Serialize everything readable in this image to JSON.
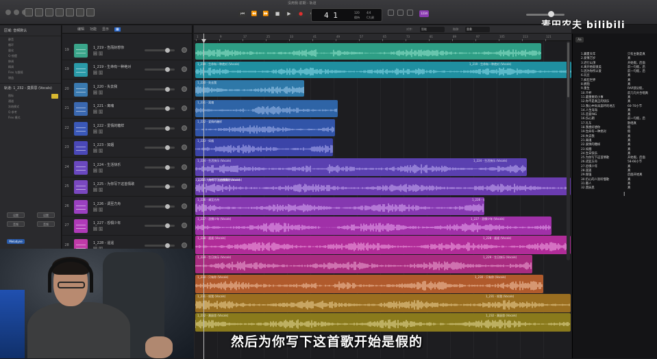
{
  "window": {
    "title": "没用我·前期 - 轨道"
  },
  "transport": {
    "rewind": "⏮",
    "back": "⏪",
    "forward": "⏩",
    "stop": "■",
    "play": "▶",
    "record": "●",
    "cycle": "⟳",
    "bar_beat": "4 1",
    "tempo": "120",
    "tempo_label": "保持",
    "key": "C大调",
    "signature": "4/4"
  },
  "badge": "1234",
  "watermark": "麦田农夫 bilibili",
  "inspector": {
    "region_header": "区域: 音频默认",
    "region_rows": [
      "静音",
      "循环",
      "量化",
      "Q-摇摆",
      "移调",
      "精调",
      "Flex 与跟随",
      "增益"
    ],
    "track_header": "轨道: 1_232 - 莫辰思 (Vocals)",
    "track_rows": [
      "图标",
      "通道",
      "冻结模式",
      "Q-参考",
      "Flex 模式"
    ],
    "btn_left": "设置",
    "btn_right": "设置",
    "btn_left2": "音频",
    "btn_right2": "音频",
    "blue_label": "Melodyne"
  },
  "track_toolbar": {
    "edit": "编辑",
    "functions": "功能",
    "view": "显示",
    "snap": "对齐",
    "drag": "拖移"
  },
  "edit_toolbar": {
    "snap_label": "对齐:",
    "snap_value": "智能",
    "drag_label": "拖移:",
    "drag_value": "重叠"
  },
  "ruler": [
    "1",
    "9",
    "17",
    "25",
    "33",
    "41",
    "49",
    "57",
    "65",
    "73",
    "81",
    "89",
    "97",
    "105",
    "113",
    "121"
  ],
  "tracks": [
    {
      "num": "19",
      "name": "1_219 - 告而好想你",
      "color": "#3aa58a"
    },
    {
      "num": "19",
      "name": "1_219 - 生命有一种绝对",
      "color": "#2a9aa8"
    },
    {
      "num": "20",
      "name": "1_220 - 失去我",
      "color": "#3a7ab0"
    },
    {
      "num": "21",
      "name": "1_221 - 离魂",
      "color": "#3a68b0"
    },
    {
      "num": "22",
      "name": "1_222 - 爱情的糖样",
      "color": "#3a58b8"
    },
    {
      "num": "23",
      "name": "1_223 - 如烟",
      "color": "#4a48b8"
    },
    {
      "num": "24",
      "name": "1_224 - 生活快乐",
      "color": "#6a48c0"
    },
    {
      "num": "25",
      "name": "1_225 - 为你写下这首情歌",
      "color": "#7a48c0"
    },
    {
      "num": "26",
      "name": "1_226 - 调至方舟",
      "color": "#9a40c0"
    },
    {
      "num": "27",
      "name": "1_227 - 恐惧少年",
      "color": "#b03ab8"
    },
    {
      "num": "28",
      "name": "1_228 - 遥遥",
      "color": "#c03aa8"
    }
  ],
  "regions": [
    {
      "label": "",
      "label2": "",
      "color": "#2e9e85",
      "light": "#8ee0c8"
    },
    {
      "label": "1_219 - 生命有一种绝对 (Vocals)",
      "label2": "1_219 - 生命有一种绝对 (Vocals)",
      "color": "#1f8fa0",
      "light": "#86d8e6"
    },
    {
      "label": "1_220 - 失去我",
      "label2": "",
      "color": "#2e78a8",
      "light": "#9cc8ea"
    },
    {
      "label": "1_221 - 离魂",
      "label2": "",
      "color": "#2e64a6",
      "light": "#9ab8e8"
    },
    {
      "label": "1_222 - 爱情的糖样",
      "label2": "",
      "color": "#3154a8",
      "light": "#a0b0ea"
    },
    {
      "label": "1_223 - 如烟",
      "label2": "",
      "color": "#3b44a8",
      "light": "#a8a8ee"
    },
    {
      "label": "1_224 - 生活快乐 (Vocals)",
      "label2": "1_224 - 生活快乐 (Vocals)",
      "color": "#5a40b0",
      "light": "#b8a8f0"
    },
    {
      "label": "1_225 - 为你写下这首情歌 (Vocals)",
      "label2": "1_225 - 为你写下这首情歌 (Vocals)",
      "color": "#6a3cb0",
      "light": "#c4a8f0"
    },
    {
      "label": "1_226 - 调至方舟",
      "label2": "1_226 - 调至方舟",
      "color": "#8538b0",
      "light": "#d4a4f0"
    },
    {
      "label": "1_227 - 恐惧少年 (Vocals)",
      "label2": "1_227 - 恐惧少年 (Vocals)",
      "color": "#a030a8",
      "light": "#e2a0ec"
    },
    {
      "label": "1_228 - 遥遥 (Vocals)",
      "label2": "1_228 - 遥遥 (Vocals)",
      "color": "#b02c98",
      "light": "#eea0e0"
    },
    {
      "label": "1_229 - 生日快乐 (Vocals)",
      "label2": "1_229 - 生日快乐 (Vocals)",
      "color": "#a82c80",
      "light": "#eaa0d0"
    },
    {
      "label": "1_230 - 只有你 (Vocals)",
      "label2": "1_230 - 只有你 (Vocals)",
      "color": "#b05a2c",
      "light": "#f0c0a0"
    },
    {
      "label": "1_231 - 如我 (Vocals)",
      "label2": "1_231 - 如我 (Vocals)",
      "color": "#9a6e20",
      "light": "#e8cc90"
    },
    {
      "label": "1_232 - 莫辰思 (Vocals)",
      "label2": "1_232 - 莫辰思 (Vocals)",
      "color": "#8a7a1c",
      "light": "#e0d490"
    }
  ],
  "song_list": [
    {
      "title": "1.藏夏天年",
      "note": "只有主歌是真"
    },
    {
      "title": "2.爱情万岁",
      "note": "真"
    },
    {
      "title": "3.迟行山顶",
      "note": "开始假，后面"
    },
    {
      "title": "4.离开他就很美",
      "note": "前一句假，后"
    },
    {
      "title": "5.因为你所以爱",
      "note": "前一句假，后"
    },
    {
      "title": "6.玩豆",
      "note": "真"
    },
    {
      "title": "7.疯狂世界",
      "note": "真"
    },
    {
      "title": "8.拥抱",
      "note": "真"
    },
    {
      "title": "9.重生",
      "note": "RAP部分假，"
    },
    {
      "title": "10.干杯",
      "note": "前几句大合唱真"
    },
    {
      "title": "11.最重要的小事",
      "note": "真"
    },
    {
      "title": "12.你不是真正的快乐",
      "note": "真"
    },
    {
      "title": "13.我心中尚未崩坏的地方",
      "note": "60-70小节"
    },
    {
      "title": "14.人生海海",
      "note": "真"
    },
    {
      "title": "15.恋爱ING",
      "note": "真"
    },
    {
      "title": "16.伤心期",
      "note": "前一句假，后"
    },
    {
      "title": "17.礼车",
      "note": "散唱真"
    },
    {
      "title": "18.我想好想你",
      "note": "假"
    },
    {
      "title": "19.生命有一种绝对",
      "note": "假"
    },
    {
      "title": "20.失去我",
      "note": "真"
    },
    {
      "title": "21.离魂",
      "note": "真"
    },
    {
      "title": "22.爱情的糖样",
      "note": "真"
    },
    {
      "title": "23.如烟",
      "note": "真"
    },
    {
      "title": "24.生日快乐",
      "note": "真"
    },
    {
      "title": "25.为你写下这首情歌",
      "note": "开始假，后面"
    },
    {
      "title": "26.诺亚方舟",
      "note": "58-66小节"
    },
    {
      "title": "27.恐惧少年",
      "note": "真"
    },
    {
      "title": "28.遥遥",
      "note": "真"
    },
    {
      "title": "29.倔强",
      "note": "后面开始真"
    },
    {
      "title": "30.仍心的人别听慢歌",
      "note": "真"
    },
    {
      "title": "31.憨人",
      "note": "真"
    },
    {
      "title": "32.莫辰思",
      "note": "真"
    }
  ],
  "rpanel_tab": "Aa",
  "subtitle": "然后为你写下这首歌开始是假的"
}
